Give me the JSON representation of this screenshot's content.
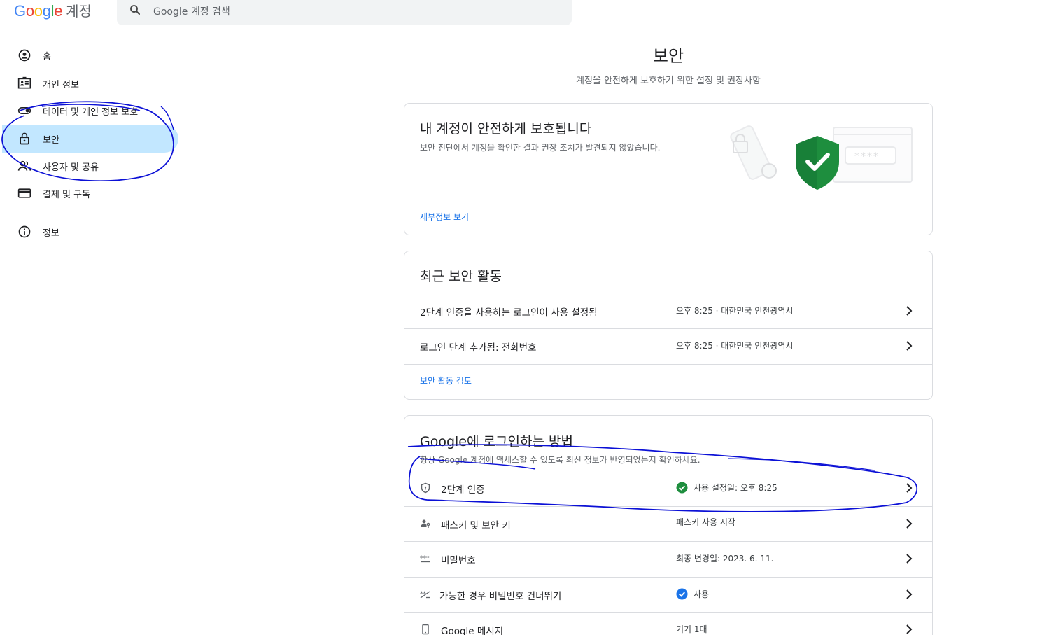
{
  "header": {
    "logo_google": "Google",
    "logo_account": "계정",
    "search_placeholder": "Google 계정 검색"
  },
  "sidebar": {
    "items": [
      {
        "label": "홈",
        "icon": "account-circle-icon"
      },
      {
        "label": "개인 정보",
        "icon": "id-card-icon"
      },
      {
        "label": "데이터 및 개인 정보 보호",
        "icon": "toggle-icon"
      },
      {
        "label": "보안",
        "icon": "lock-icon",
        "active": true
      },
      {
        "label": "사용자 및 공유",
        "icon": "people-icon"
      },
      {
        "label": "결제 및 구독",
        "icon": "credit-card-icon"
      },
      {
        "label": "정보",
        "icon": "info-icon"
      }
    ]
  },
  "main": {
    "title": "보안",
    "subtitle": "계정을 안전하게 보호하기 위한 설정 및 권장사항"
  },
  "status_card": {
    "title": "내 계정이 안전하게 보호됩니다",
    "desc": "보안 진단에서 계정을 확인한 결과 권장 조치가 발견되지 않았습니다.",
    "link": "세부정보 보기",
    "stars": "****"
  },
  "activity_card": {
    "title": "최근 보안 활동",
    "rows": [
      {
        "label": "2단계 인증을 사용하는 로그인이 사용 설정됨",
        "value": "오후 8:25 · 대한민국 인천광역시"
      },
      {
        "label": "로그인 단계 추가됨: 전화번호",
        "value": "오후 8:25 · 대한민국 인천광역시"
      }
    ],
    "link": "보안 활동 검토"
  },
  "signin_card": {
    "title": "Google에 로그인하는 방법",
    "desc": "항상 Google 계정에 액세스할 수 있도록 최신 정보가 반영되었는지 확인하세요.",
    "rows": [
      {
        "label": "2단계 인증",
        "value": "사용 설정일: 오후 8:25",
        "icon": "shield-icon",
        "status": "green-check"
      },
      {
        "label": "패스키 및 보안 키",
        "value": "패스키 사용 시작",
        "icon": "person-key-icon"
      },
      {
        "label": "비밀번호",
        "value": "최종 변경일: 2023. 6. 11.",
        "icon": "password-dots-icon"
      },
      {
        "label": "가능한 경우 비밀번호 건너뛰기",
        "value": "사용",
        "icon": "skip-password-icon",
        "status": "blue-check"
      },
      {
        "label": "Google 메시지",
        "value": "기기 1대",
        "icon": "phone-icon"
      }
    ]
  },
  "colors": {
    "accent": "#1a73e8",
    "nav_active_bg": "#c2e7ff",
    "annotation": "#0b10d6",
    "shield": "#1e8e3e",
    "check_green": "#1e8e3e",
    "check_blue": "#1a73e8"
  }
}
